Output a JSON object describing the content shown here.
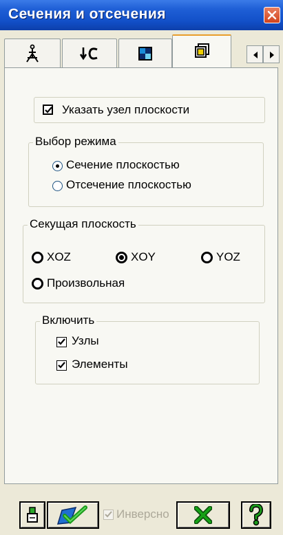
{
  "window": {
    "title": "Сечения и отсечения"
  },
  "tabs": [
    {
      "icon": "structure-icon",
      "active": false
    },
    {
      "icon": "node-link-icon",
      "active": false
    },
    {
      "icon": "color-grid-icon",
      "active": false
    },
    {
      "icon": "layers-icon",
      "active": true
    }
  ],
  "specify_node": {
    "label": "Указать узел плоскости",
    "checked": true
  },
  "mode_group": {
    "legend": "Выбор режима",
    "options": [
      {
        "label": "Сечение плоскостью",
        "selected": true
      },
      {
        "label": "Отсечение плоскостью",
        "selected": false
      }
    ]
  },
  "plane_group": {
    "legend": "Секущая плоскость",
    "options": [
      {
        "label": "XOZ",
        "selected": false
      },
      {
        "label": "XOY",
        "selected": true
      },
      {
        "label": "YOZ",
        "selected": false
      },
      {
        "label": "Произвольная",
        "selected": false
      }
    ]
  },
  "include_group": {
    "legend": "Включить",
    "items": [
      {
        "label": "Узлы",
        "checked": true
      },
      {
        "label": "Элементы",
        "checked": true
      }
    ]
  },
  "bottom": {
    "invert_label": "Инверсно",
    "invert_checked": true,
    "invert_enabled": false,
    "buttons": [
      "print-icon",
      "apply-check-icon",
      "close-x-icon",
      "help-icon"
    ]
  },
  "colors": {
    "title_bar": "#1250c8",
    "panel_bg": "#f8f8f3",
    "accent_check": "#21a121",
    "close_x": "#16a116",
    "help_mark": "#1a9a1a"
  }
}
